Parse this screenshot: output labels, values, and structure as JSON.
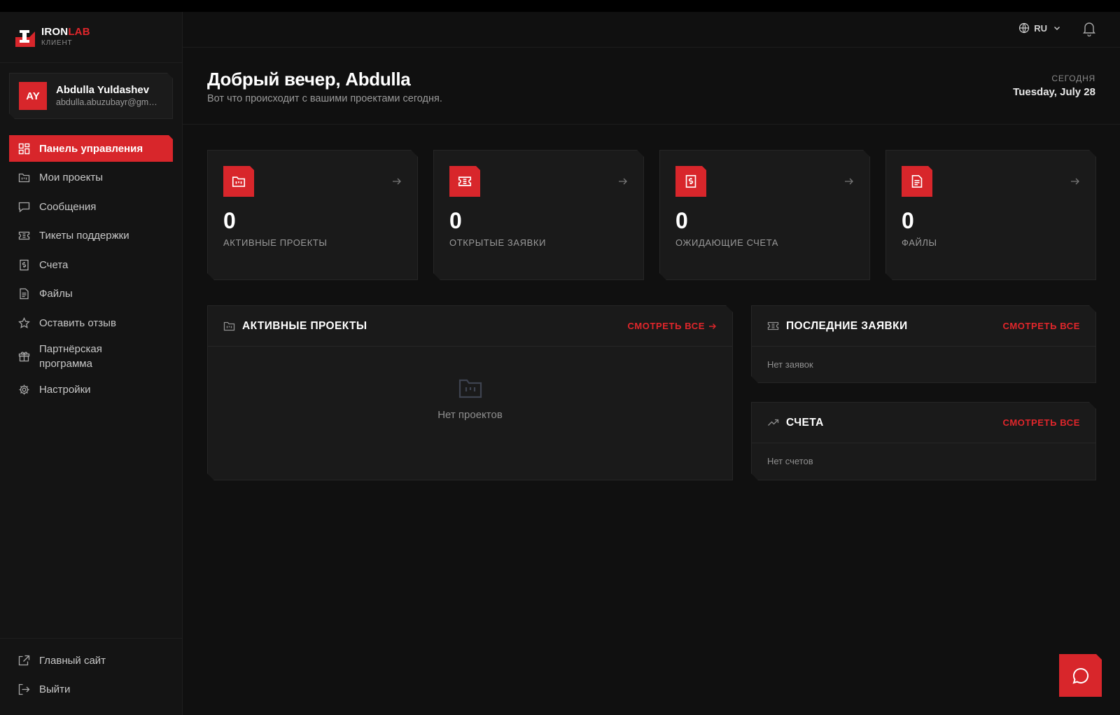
{
  "brand": {
    "name_part1": "IRON",
    "name_part2": "LAB",
    "subtitle": "КЛИЕНТ"
  },
  "user": {
    "initials": "AY",
    "name": "Abdulla Yuldashev",
    "email": "abdulla.abuzubayr@gmail.com"
  },
  "nav": [
    {
      "label": "Панель управления",
      "icon": "dashboard-icon",
      "active": true
    },
    {
      "label": "Мои проекты",
      "icon": "projects-icon"
    },
    {
      "label": "Сообщения",
      "icon": "messages-icon"
    },
    {
      "label": "Тикеты поддержки",
      "icon": "ticket-icon"
    },
    {
      "label": "Счета",
      "icon": "invoice-icon"
    },
    {
      "label": "Файлы",
      "icon": "file-icon"
    },
    {
      "label": "Оставить отзыв",
      "icon": "star-icon"
    },
    {
      "label": "Партнёрская программа",
      "icon": "gift-icon"
    },
    {
      "label": "Настройки",
      "icon": "gear-icon"
    }
  ],
  "footer_nav": [
    {
      "label": "Главный сайт",
      "icon": "external-link-icon"
    },
    {
      "label": "Выйти",
      "icon": "logout-icon"
    }
  ],
  "topbar": {
    "language": "RU"
  },
  "header": {
    "greeting": "Добрый вечер, Abdulla",
    "subtitle": "Вот что происходит с вашими проектами сегодня.",
    "today_label": "СЕГОДНЯ",
    "today_date": "Tuesday, July 28"
  },
  "stats": [
    {
      "value": "0",
      "label": "АКТИВНЫЕ ПРОЕКТЫ",
      "icon": "projects-icon"
    },
    {
      "value": "0",
      "label": "ОТКРЫТЫЕ ЗАЯВКИ",
      "icon": "ticket-icon"
    },
    {
      "value": "0",
      "label": "ОЖИДАЮЩИЕ СЧЕТА",
      "icon": "invoice-icon"
    },
    {
      "value": "0",
      "label": "ФАЙЛЫ",
      "icon": "file-icon"
    }
  ],
  "panels": {
    "active_projects": {
      "title": "АКТИВНЫЕ ПРОЕКТЫ",
      "link": "СМОТРЕТЬ ВСЕ",
      "empty": "Нет проектов"
    },
    "recent_tickets": {
      "title": "ПОСЛЕДНИЕ ЗАЯВКИ",
      "link": "СМОТРЕТЬ ВСЕ",
      "empty": "Нет заявок"
    },
    "invoices": {
      "title": "СЧЕТА",
      "link": "СМОТРЕТЬ ВСЕ",
      "empty": "Нет счетов"
    }
  },
  "colors": {
    "accent": "#d8262b",
    "background": "#101010",
    "card": "#1a1a1a"
  }
}
